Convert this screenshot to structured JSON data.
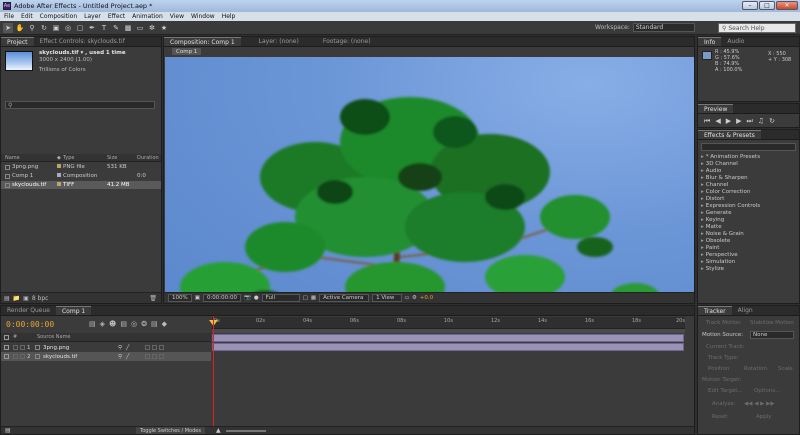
{
  "window": {
    "title": "Adobe After Effects - Untitled Project.aep *",
    "app_icon": "Ae"
  },
  "menu": [
    "File",
    "Edit",
    "Composition",
    "Layer",
    "Effect",
    "Animation",
    "View",
    "Window",
    "Help"
  ],
  "toolbar": {
    "workspace_label": "Workspace:",
    "workspace_value": "Standard",
    "search_placeholder": "Search Help"
  },
  "project": {
    "tabs": [
      "Project",
      "Effect Controls: skyclouds.tif"
    ],
    "selected_name": "skyclouds.tif ▾ , used 1 time",
    "dimensions": "3000 x 2400 (1.00)",
    "colors": "Trillions of Colors",
    "columns": [
      "Name",
      "",
      "Type",
      "Size",
      "Duration"
    ],
    "items": [
      {
        "name": "3png.png",
        "type": "PNG file",
        "size": "531 KB",
        "duration": "",
        "swatch": "#b9a76a"
      },
      {
        "name": "Comp 1",
        "type": "Composition",
        "size": "",
        "duration": "0:0",
        "swatch": "#a8a8c8"
      },
      {
        "name": "skyclouds.tif",
        "type": "TIFF",
        "size": "41.2 MB",
        "duration": "",
        "swatch": "#b9a76a"
      }
    ],
    "bpc": "8 bpc"
  },
  "composition": {
    "tabs": [
      "Composition: Comp 1",
      "Layer: (none)",
      "Footage: (none)"
    ],
    "chip": "Comp 1",
    "footer": {
      "zoom": "100%",
      "time": "0:00:00:00",
      "resolution": "Full",
      "camera": "Active Camera",
      "views": "1 View",
      "offset": "+0.0"
    }
  },
  "info": {
    "tabs": [
      "Info",
      "Audio"
    ],
    "r": "R : 45.9%",
    "g": "G : 57.6%",
    "b": "B : 74.9%",
    "a": "A : 100.0%",
    "x": "X : 550",
    "y": "+ Y : 308",
    "swatch": "#7c9ac7"
  },
  "preview": {
    "tab": "Preview"
  },
  "effects": {
    "tab": "Effects & Presets",
    "items": [
      "* Animation Presets",
      "3D Channel",
      "Audio",
      "Blur & Sharpen",
      "Channel",
      "Color Correction",
      "Distort",
      "Expression Controls",
      "Generate",
      "Keying",
      "Matte",
      "Noise & Grain",
      "Obsolete",
      "Paint",
      "Perspective",
      "Simulation",
      "Stylize"
    ]
  },
  "timeline": {
    "tabs": [
      "Render Queue",
      "Comp 1"
    ],
    "timecode": "0:00:00:00",
    "column_source": "Source Name",
    "layers": [
      {
        "num": "1",
        "name": "3png.png"
      },
      {
        "num": "2",
        "name": "skyclouds.tif"
      }
    ],
    "ruler": [
      "0s",
      "02s",
      "04s",
      "06s",
      "08s",
      "10s",
      "12s",
      "14s",
      "16s",
      "18s",
      "20s"
    ],
    "toggle_label": "Toggle Switches / Modes"
  },
  "tracker": {
    "tabs": [
      "Tracker",
      "Align"
    ],
    "track_motion": "Track Motion",
    "stabilize_motion": "Stabilize Motion",
    "motion_source_label": "Motion Source:",
    "motion_source_value": "None",
    "current_track": "Current Track:",
    "track_type": "Track Type:",
    "position": "Position",
    "rotation": "Rotation",
    "scale": "Scale",
    "motion_target": "Motion Target:",
    "edit_target": "Edit Target...",
    "options": "Options...",
    "analyze": "Analyze:",
    "reset": "Reset",
    "apply": "Apply"
  }
}
